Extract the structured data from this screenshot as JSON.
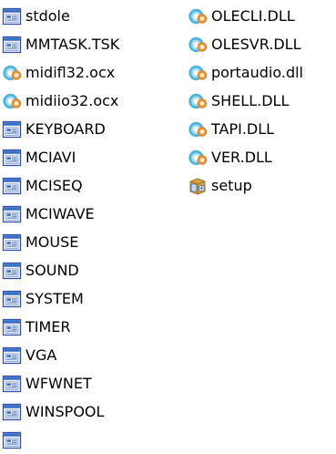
{
  "colors": {
    "background": "#ffffff",
    "text": "#000000",
    "app_icon_blue": "#3a6fc6",
    "app_icon_title": "#2f4fa8",
    "dll_icon_cyan": "#4fb4d8",
    "dll_icon_orange": "#e5862a",
    "setup_icon_box": "#d9a441"
  },
  "files": {
    "column1": [
      {
        "label": "stdole",
        "icon": "app-window-icon"
      },
      {
        "label": "MMTASK.TSK",
        "icon": "app-window-icon"
      },
      {
        "label": "midifl32.ocx",
        "icon": "gear-file-icon"
      },
      {
        "label": "midiio32.ocx",
        "icon": "gear-file-icon"
      },
      {
        "label": "KEYBOARD",
        "icon": "app-window-icon"
      },
      {
        "label": "MCIAVI",
        "icon": "app-window-icon"
      },
      {
        "label": "MCISEQ",
        "icon": "app-window-icon"
      },
      {
        "label": "MCIWAVE",
        "icon": "app-window-icon"
      },
      {
        "label": "MOUSE",
        "icon": "app-window-icon"
      },
      {
        "label": "SOUND",
        "icon": "app-window-icon"
      },
      {
        "label": "SYSTEM",
        "icon": "app-window-icon"
      },
      {
        "label": "TIMER",
        "icon": "app-window-icon"
      },
      {
        "label": "VGA",
        "icon": "app-window-icon"
      },
      {
        "label": "WFWNET",
        "icon": "app-window-icon"
      },
      {
        "label": "WINSPOOL",
        "icon": "app-window-icon"
      }
    ],
    "column2": [
      {
        "label": "OLECLI.DLL",
        "icon": "gear-file-icon"
      },
      {
        "label": "OLESVR.DLL",
        "icon": "gear-file-icon"
      },
      {
        "label": "portaudio.dll",
        "icon": "gear-file-icon"
      },
      {
        "label": "SHELL.DLL",
        "icon": "gear-file-icon"
      },
      {
        "label": "TAPI.DLL",
        "icon": "gear-file-icon"
      },
      {
        "label": "VER.DLL",
        "icon": "gear-file-icon"
      },
      {
        "label": "setup",
        "icon": "setup-installer-icon"
      }
    ]
  }
}
